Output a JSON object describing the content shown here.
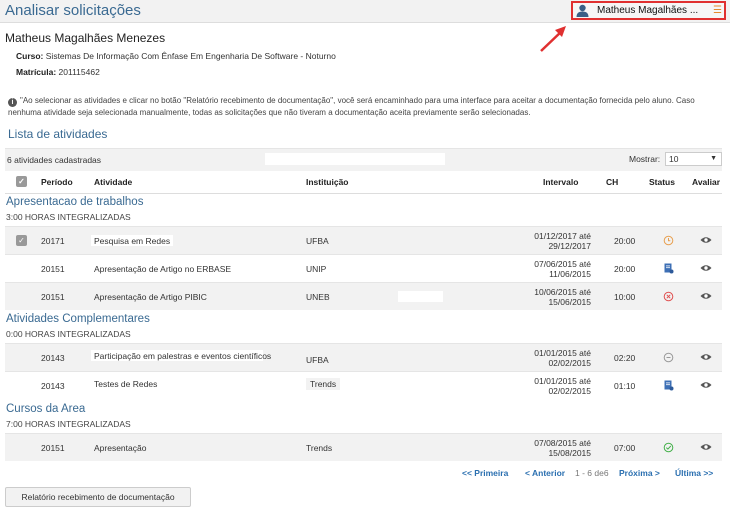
{
  "page_title": "Analisar solicitações",
  "user": {
    "name": "Matheus Magalhães ..."
  },
  "student": {
    "name": "Matheus Magalhães Menezes",
    "course_label": "Curso:",
    "course": "Sistemas De Informação Com Ênfase Em Engenharia De Software - Noturno",
    "enrollment_label": "Matrícula:",
    "enrollment": "201115462"
  },
  "notice": "\"Ao selecionar as atividades e clicar no botão \"Relatório recebimento de documentação\", você será encaminhado para uma interface para aceitar a documentação fornecida pelo aluno. Caso nenhuma atividade seja selecionada manualmente, todas as solicitações que não tiveram a documentação aceita previamente serão selecionadas.",
  "list_title": "Lista de atividades",
  "list_count": "6 atividades cadastradas",
  "show_label": "Mostrar:",
  "show_value": "10",
  "columns": {
    "periodo": "Período",
    "atividade": "Atividade",
    "instituicao": "Instituição",
    "intervalo": "Intervalo",
    "ch": "CH",
    "status": "Status",
    "avaliar": "Avaliar"
  },
  "groups": [
    {
      "title": "Apresentacao de trabalhos",
      "subtitle": "3:00 HORAS INTEGRALIZADAS",
      "rows": [
        {
          "periodo": "20171",
          "atividade": "Pesquisa em Redes",
          "instituicao": "UFBA",
          "inicio": "01/12/2017 até",
          "fim": "29/12/2017",
          "ch": "20:00",
          "status": "pending-clock-icon",
          "checked": true
        },
        {
          "periodo": "20151",
          "atividade": "Apresentação de Artigo no ERBASE",
          "instituicao": "UNIP",
          "inicio": "07/06/2015 até",
          "fim": "11/06/2015",
          "ch": "20:00",
          "status": "document-icon",
          "checked": false
        },
        {
          "periodo": "20151",
          "atividade": "Apresentação de Artigo PIBIC",
          "instituicao": "UNEB",
          "inicio": "10/06/2015 até",
          "fim": "15/06/2015",
          "ch": "10:00",
          "status": "rejected-icon",
          "checked": false
        }
      ]
    },
    {
      "title": "Atividades Complementares",
      "subtitle": "0:00 HORAS INTEGRALIZADAS",
      "rows": [
        {
          "periodo": "20143",
          "atividade": "Participação em palestras e eventos científicos",
          "instituicao": "UFBA",
          "inicio": "01/01/2015 até",
          "fim": "02/02/2015",
          "ch": "02:20",
          "status": "neutral-icon",
          "checked": false
        },
        {
          "periodo": "20143",
          "atividade": "Testes de Redes",
          "instituicao": "Trends",
          "inicio": "01/01/2015 até",
          "fim": "02/02/2015",
          "ch": "01:10",
          "status": "document-icon",
          "checked": false
        }
      ]
    },
    {
      "title": "Cursos da Area",
      "subtitle": "7:00 HORAS INTEGRALIZADAS",
      "rows": [
        {
          "periodo": "20151",
          "atividade": "Apresentação",
          "instituicao": "Trends",
          "inicio": "07/08/2015 até",
          "fim": "15/08/2015",
          "ch": "07:00",
          "status": "approved-icon",
          "checked": false
        }
      ]
    }
  ],
  "pager": {
    "first": "<< Primeira",
    "prev": "< Anterior",
    "range_prefix": "1 - 6",
    "range_suffix": "de",
    "total": "6",
    "next": "Próxima >",
    "last": "Última >>"
  },
  "report_button": "Relatório recebimento de documentação",
  "colors": {
    "title_blue": "#3a6a92",
    "link_blue": "#2a6fb0",
    "highlight_red": "#e03030",
    "clock_orange": "#e8a050",
    "reject_red": "#e05050",
    "approve_green": "#44b04a",
    "doc_blue": "#3d6fb5"
  }
}
